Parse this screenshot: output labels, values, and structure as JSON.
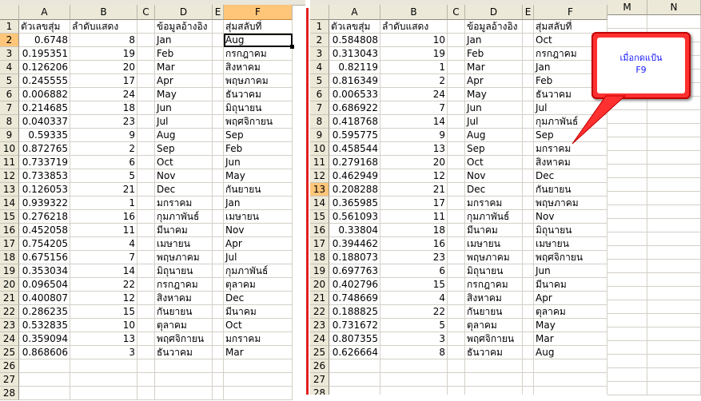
{
  "left_sheet": {
    "columns": [
      "A",
      "B",
      "C",
      "D",
      "E",
      "F"
    ],
    "selected_column": "F",
    "selected_row": "2",
    "headers": [
      "ตัวเลขสุ่ม",
      "ลำดับแสดง",
      "",
      "ข้อมูลอ้างอิง",
      "",
      "สุ่มสลับที่"
    ],
    "rows": [
      [
        "2",
        "0.6748",
        "8",
        "",
        "Jan",
        "",
        "Aug"
      ],
      [
        "3",
        "0.195351",
        "19",
        "",
        "Feb",
        "",
        "กรกฎาคม"
      ],
      [
        "4",
        "0.126206",
        "20",
        "",
        "Mar",
        "",
        "สิงหาคม"
      ],
      [
        "5",
        "0.245555",
        "17",
        "",
        "Apr",
        "",
        "พฤษภาคม"
      ],
      [
        "6",
        "0.006882",
        "24",
        "",
        "May",
        "",
        "ธันวาคม"
      ],
      [
        "7",
        "0.214685",
        "18",
        "",
        "Jun",
        "",
        "มิถุนายน"
      ],
      [
        "8",
        "0.040337",
        "23",
        "",
        "Jul",
        "",
        "พฤศจิกายน"
      ],
      [
        "9",
        "0.59335",
        "9",
        "",
        "Aug",
        "",
        "Sep"
      ],
      [
        "10",
        "0.872765",
        "2",
        "",
        "Sep",
        "",
        "Feb"
      ],
      [
        "11",
        "0.733719",
        "6",
        "",
        "Oct",
        "",
        "Jun"
      ],
      [
        "12",
        "0.733853",
        "5",
        "",
        "Nov",
        "",
        "May"
      ],
      [
        "13",
        "0.126053",
        "21",
        "",
        "Dec",
        "",
        "กันยายน"
      ],
      [
        "14",
        "0.939322",
        "1",
        "",
        "มกราคม",
        "",
        "Jan"
      ],
      [
        "15",
        "0.276218",
        "16",
        "",
        "กุมภาพันธ์",
        "",
        "เมษายน"
      ],
      [
        "16",
        "0.452058",
        "11",
        "",
        "มีนาคม",
        "",
        "Nov"
      ],
      [
        "17",
        "0.754205",
        "4",
        "",
        "เมษายน",
        "",
        "Apr"
      ],
      [
        "18",
        "0.675156",
        "7",
        "",
        "พฤษภาคม",
        "",
        "Jul"
      ],
      [
        "19",
        "0.353034",
        "14",
        "",
        "มิถุนายน",
        "",
        "กุมภาพันธ์"
      ],
      [
        "20",
        "0.096504",
        "22",
        "",
        "กรกฎาคม",
        "",
        "ตุลาคม"
      ],
      [
        "21",
        "0.400807",
        "12",
        "",
        "สิงหาคม",
        "",
        "Dec"
      ],
      [
        "22",
        "0.286235",
        "15",
        "",
        "กันยายน",
        "",
        "มีนาคม"
      ],
      [
        "23",
        "0.532835",
        "10",
        "",
        "ตุลาคม",
        "",
        "Oct"
      ],
      [
        "24",
        "0.359094",
        "13",
        "",
        "พฤศจิกายน",
        "",
        "มกราคม"
      ],
      [
        "25",
        "0.868606",
        "3",
        "",
        "ธันวาคม",
        "",
        "Mar"
      ],
      [
        "26",
        "",
        "",
        "",
        "",
        "",
        ""
      ],
      [
        "27",
        "",
        "",
        "",
        "",
        "",
        ""
      ],
      [
        "28",
        "",
        "",
        "",
        "",
        "",
        ""
      ]
    ]
  },
  "right_sheet": {
    "columns": [
      "A",
      "B",
      "C",
      "D",
      "E",
      "F"
    ],
    "selected_row": "13",
    "headers": [
      "ตัวเลขสุ่ม",
      "ลำดับแสดง",
      "",
      "ข้อมูลอ้างอิง",
      "",
      "สุ่มสลับที่"
    ],
    "rows": [
      [
        "2",
        "0.584808",
        "10",
        "",
        "Jan",
        "",
        "Oct"
      ],
      [
        "3",
        "0.313043",
        "19",
        "",
        "Feb",
        "",
        "กรกฎาคม"
      ],
      [
        "4",
        "0.82119",
        "1",
        "",
        "Mar",
        "",
        "Jan"
      ],
      [
        "5",
        "0.816349",
        "2",
        "",
        "Apr",
        "",
        "Feb"
      ],
      [
        "6",
        "0.006533",
        "24",
        "",
        "May",
        "",
        "ธันวาคม"
      ],
      [
        "7",
        "0.686922",
        "7",
        "",
        "Jun",
        "",
        "Jul"
      ],
      [
        "8",
        "0.418768",
        "14",
        "",
        "Jul",
        "",
        "กุมภาพันธ์"
      ],
      [
        "9",
        "0.595775",
        "9",
        "",
        "Aug",
        "",
        "Sep"
      ],
      [
        "10",
        "0.458544",
        "13",
        "",
        "Sep",
        "",
        "มกราคม"
      ],
      [
        "11",
        "0.279168",
        "20",
        "",
        "Oct",
        "",
        "สิงหาคม"
      ],
      [
        "12",
        "0.462949",
        "12",
        "",
        "Nov",
        "",
        "Dec"
      ],
      [
        "13",
        "0.208288",
        "21",
        "",
        "Dec",
        "",
        "กันยายน"
      ],
      [
        "14",
        "0.365985",
        "17",
        "",
        "มกราคม",
        "",
        "พฤษภาคม"
      ],
      [
        "15",
        "0.561093",
        "11",
        "",
        "กุมภาพันธ์",
        "",
        "Nov"
      ],
      [
        "16",
        "0.33804",
        "18",
        "",
        "มีนาคม",
        "",
        "มิถุนายน"
      ],
      [
        "17",
        "0.394462",
        "16",
        "",
        "เมษายน",
        "",
        "เมษายน"
      ],
      [
        "18",
        "0.188073",
        "23",
        "",
        "พฤษภาคม",
        "",
        "พฤศจิกายน"
      ],
      [
        "19",
        "0.697763",
        "6",
        "",
        "มิถุนายน",
        "",
        "Jun"
      ],
      [
        "20",
        "0.402796",
        "15",
        "",
        "กรกฎาคม",
        "",
        "มีนาคม"
      ],
      [
        "21",
        "0.748669",
        "4",
        "",
        "สิงหาคม",
        "",
        "Apr"
      ],
      [
        "22",
        "0.188825",
        "22",
        "",
        "กันยายน",
        "",
        "ตุลาคม"
      ],
      [
        "23",
        "0.731672",
        "5",
        "",
        "ตุลาคม",
        "",
        "May"
      ],
      [
        "24",
        "0.807355",
        "3",
        "",
        "พฤศจิกายน",
        "",
        "Mar"
      ],
      [
        "25",
        "0.626664",
        "8",
        "",
        "ธันวาคม",
        "",
        "Aug"
      ],
      [
        "26",
        "",
        "",
        "",
        "",
        "",
        ""
      ],
      [
        "27",
        "",
        "",
        "",
        "",
        "",
        ""
      ],
      [
        "28",
        "",
        "",
        "",
        "",
        "",
        ""
      ]
    ]
  },
  "extra_columns": [
    "M",
    "N"
  ],
  "callout": {
    "line1": "เมื่อกดแป้น",
    "line2": "F9"
  },
  "colors": {
    "header_bg": "#ece9d8",
    "selected_header_bg": "#ffc67a",
    "callout_red": "#ff3030",
    "callout_text": "#1a1aff",
    "divider_red": "#e02020"
  }
}
